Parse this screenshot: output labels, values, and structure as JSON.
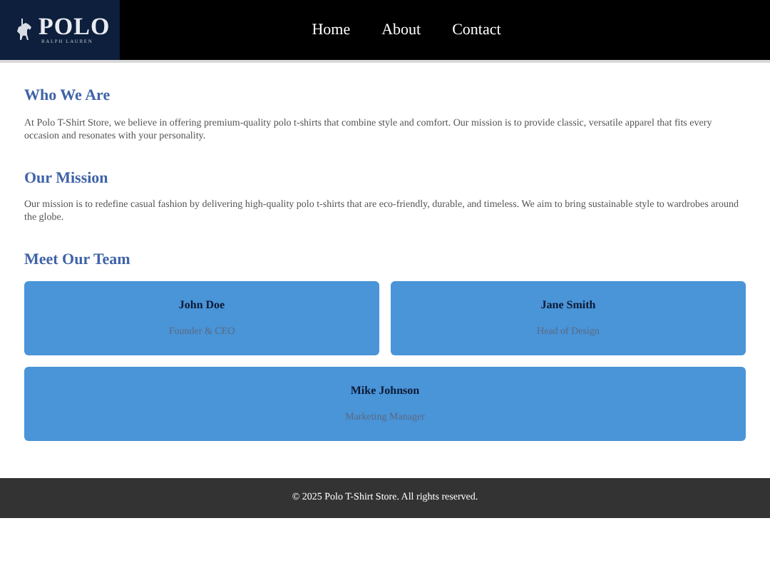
{
  "logo": {
    "title": "POLO",
    "subtitle": "RALPH LAUREN"
  },
  "nav": [
    {
      "label": "Home"
    },
    {
      "label": "About"
    },
    {
      "label": "Contact"
    }
  ],
  "sections": [
    {
      "heading": "Who We Are",
      "text": "At Polo T-Shirt Store, we believe in offering premium-quality polo t-shirts that combine style and comfort. Our mission is to provide classic, versatile apparel that fits every occasion and resonates with your personality."
    },
    {
      "heading": "Our Mission",
      "text": "Our mission is to redefine casual fashion by delivering high-quality polo t-shirts that are eco-friendly, durable, and timeless. We aim to bring sustainable style to wardrobes around the globe."
    }
  ],
  "team": {
    "heading": "Meet Our Team",
    "members": [
      {
        "name": "John Doe",
        "role": "Founder & CEO"
      },
      {
        "name": "Jane Smith",
        "role": "Head of Design"
      },
      {
        "name": "Mike Johnson",
        "role": "Marketing Manager"
      }
    ]
  },
  "footer": "© 2025 Polo T-Shirt Store. All rights reserved."
}
